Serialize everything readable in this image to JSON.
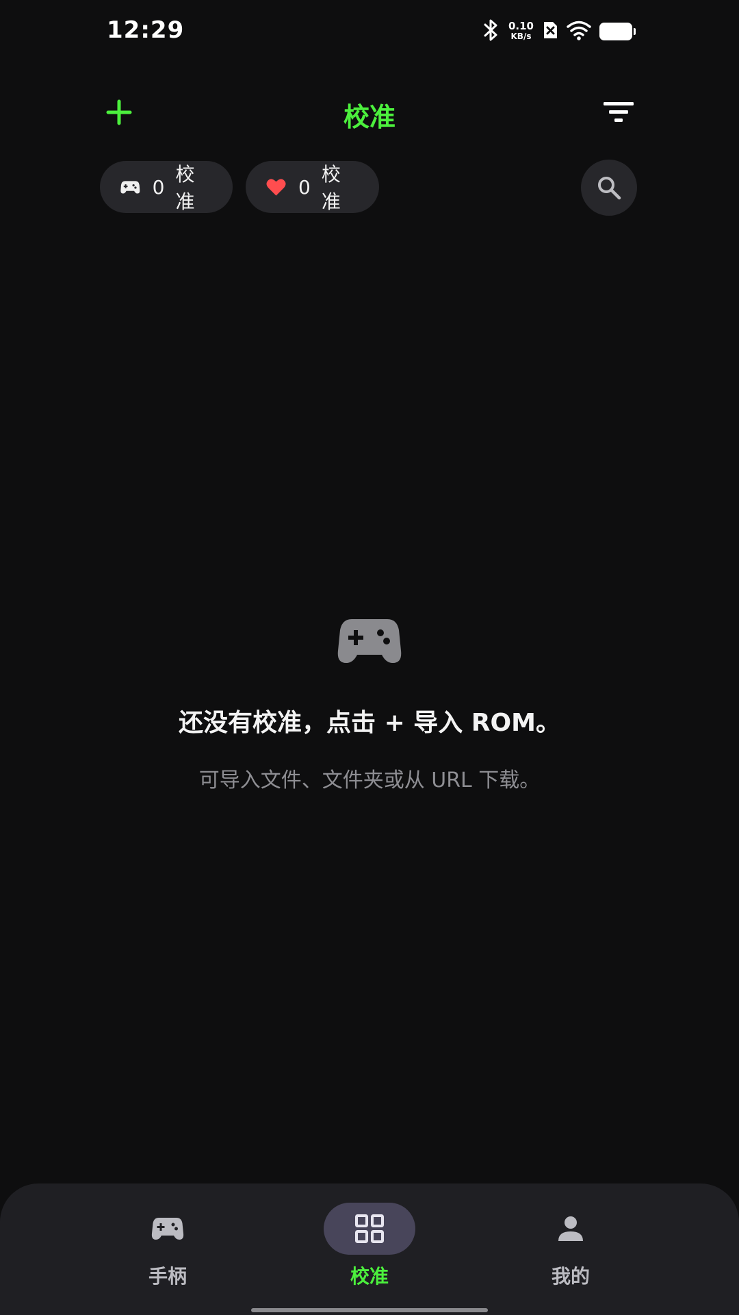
{
  "status_bar": {
    "time": "12:29",
    "net_speed_value": "0.10",
    "net_speed_unit": "KB/s",
    "icons": [
      "bluetooth-icon",
      "sim-off-icon",
      "wifi-icon",
      "battery-icon"
    ]
  },
  "app_bar": {
    "title": "校准",
    "add_icon": "plus-icon",
    "filter_icon": "filter-icon",
    "accent_color": "#4cf03d"
  },
  "chips": {
    "controllers": {
      "count": "0",
      "label": "校准",
      "icon": "gamepad-icon"
    },
    "favorites": {
      "count": "0",
      "label": "校准",
      "icon": "heart-icon",
      "icon_color": "#ff4d4f"
    }
  },
  "search": {
    "icon": "search-icon"
  },
  "empty_state": {
    "icon": "gamepad-icon",
    "title": "还没有校准，点击 + 导入 ROM。",
    "subtitle": "可导入文件、文件夹或从 URL 下载。"
  },
  "bottom_nav": {
    "items": [
      {
        "label": "手柄",
        "icon": "gamepad-icon",
        "active": false
      },
      {
        "label": "校准",
        "icon": "grid-icon",
        "active": true
      },
      {
        "label": "我的",
        "icon": "person-icon",
        "active": false
      }
    ]
  }
}
